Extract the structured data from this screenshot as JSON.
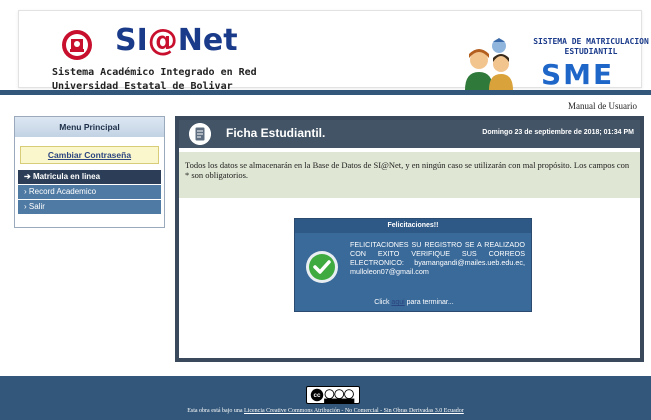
{
  "header": {
    "logo_si": "SI",
    "logo_at": "@",
    "logo_net": "Net",
    "subtitle_1": "Sistema Académico Integrado en Red",
    "subtitle_2": "Universidad Estatal de Bolivar",
    "sme_title": "SISTEMA DE MATRICULACION ESTUDIANTIL",
    "sme_acronym": "SME",
    "manual_link": "Manual de Usuario"
  },
  "sidebar": {
    "heading": "Menu Principal",
    "change_password": "Cambiar Contraseña",
    "items": [
      {
        "label": "Matricula en linea",
        "active": true
      },
      {
        "label": "Record Academico",
        "active": false
      },
      {
        "label": "Salir",
        "active": false
      }
    ]
  },
  "main": {
    "title": "Ficha Estudiantil.",
    "date": "Domingo 23 de septiembre de 2018; 01:34 PM",
    "notice": "Todos los datos se almacenarán en la Base de Datos de SI@Net, y en ningún caso se utilizarán con mal propósito. Los campos con * son obligatorios.",
    "dialog": {
      "heading": "Felicitaciones!!",
      "message": "FELICITACIONES SU REGISTRO SE A REALIZADO CON EXITO VERIFIQUE SUS CORREOS ELECTRONICO: byamangandi@mailes.ueb.edu.ec, mulloleon07@gmail.com",
      "footer_prefix": "Click",
      "footer_link": "aqui",
      "footer_suffix": "para terminar..."
    }
  },
  "footer": {
    "cc_label": "CC BY NC ND",
    "text_prefix": "Esta obra está bajo una",
    "license": "Licencia Creative Commons Atribución - No Comercial - Sin Obras Derivadas 3.0 Ecuador"
  },
  "colors": {
    "brand_navy": "#1a3a8a",
    "brand_red": "#c8102e",
    "bar_blue": "#33577a",
    "panel_dark": "#435466",
    "dialog_blue": "#3a6a9a"
  }
}
